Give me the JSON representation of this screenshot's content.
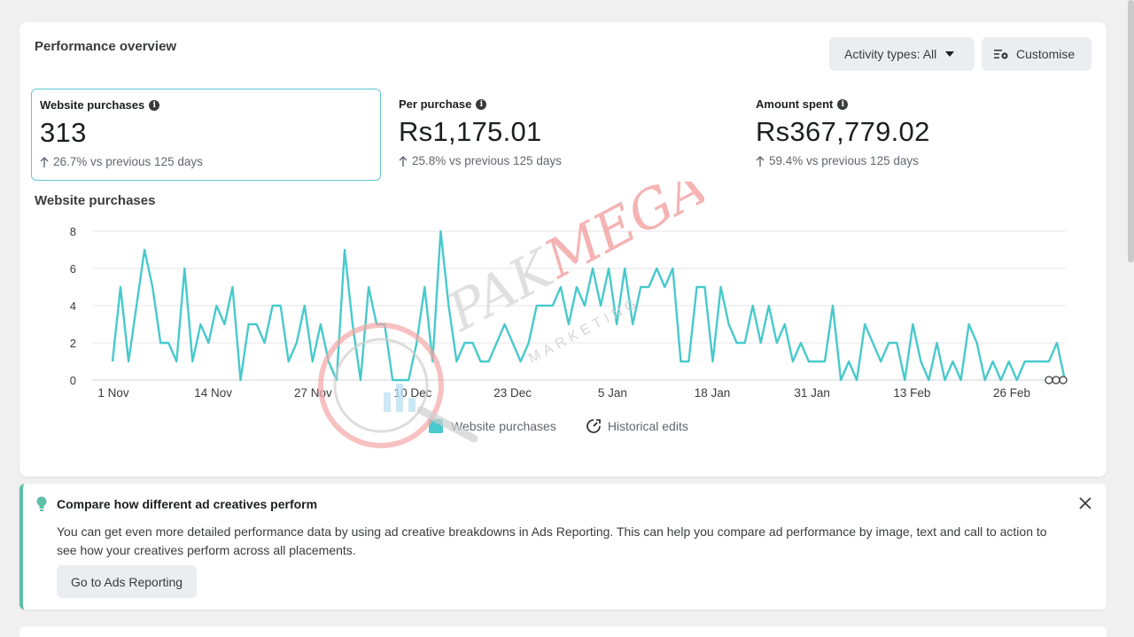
{
  "overview": {
    "title": "Performance overview",
    "activity_label": "Activity types: All",
    "customise_label": "Customise"
  },
  "metrics": [
    {
      "label": "Website purchases",
      "value": "313",
      "change": "26.7% vs previous 125 days"
    },
    {
      "label": "Per purchase",
      "value": "Rs1,175.01",
      "change": "25.8% vs previous 125 days"
    },
    {
      "label": "Amount spent",
      "value": "Rs367,779.02",
      "change": "59.4% vs previous 125 days"
    }
  ],
  "chart_title": "Website purchases",
  "legend": {
    "series_label": "Website purchases",
    "historical_label": "Historical edits"
  },
  "chart_data": {
    "type": "line",
    "title": "Website purchases",
    "xlabel": "",
    "ylabel": "",
    "ylim": [
      0,
      8
    ],
    "yticks": [
      0,
      2,
      4,
      6,
      8
    ],
    "xtick_labels": [
      "1 Nov",
      "14 Nov",
      "27 Nov",
      "10 Dec",
      "23 Dec",
      "5 Jan",
      "18 Jan",
      "31 Jan",
      "13 Feb",
      "26 Feb"
    ],
    "grid": true,
    "series": [
      {
        "name": "Website purchases",
        "color": "#48c9cc",
        "values": [
          1,
          5,
          1,
          4,
          7,
          5,
          2,
          2,
          1,
          6,
          1,
          3,
          2,
          4,
          3,
          5,
          0,
          3,
          3,
          2,
          4,
          4,
          1,
          2,
          4,
          1,
          3,
          1,
          0,
          7,
          3,
          0,
          5,
          3,
          3,
          0,
          0,
          0,
          2,
          5,
          1,
          8,
          4,
          1,
          2,
          2,
          1,
          1,
          2,
          3,
          2,
          1,
          2,
          4,
          4,
          4,
          5,
          3,
          5,
          4,
          6,
          4,
          6,
          3,
          6,
          3,
          5,
          5,
          6,
          5,
          6,
          1,
          1,
          5,
          5,
          1,
          5,
          3,
          2,
          2,
          4,
          2,
          4,
          2,
          3,
          1,
          2,
          1,
          1,
          1,
          4,
          0,
          1,
          0,
          3,
          2,
          1,
          2,
          2,
          0,
          3,
          1,
          0,
          2,
          0,
          1,
          0,
          3,
          2,
          0,
          1,
          0,
          1,
          0,
          1,
          1,
          1,
          1,
          2,
          0
        ]
      }
    ]
  },
  "tip": {
    "title": "Compare how different ad creatives perform",
    "body": "You can get even more detailed performance data by using ad creative breakdowns in Ads Reporting. This can help you compare ad performance by image, text and call to action to see how your creatives perform across all placements.",
    "button_label": "Go to Ads Reporting"
  },
  "watermark": {
    "brand": "PAK",
    "brand2": "MEGA",
    "sub": "MARKETING"
  }
}
